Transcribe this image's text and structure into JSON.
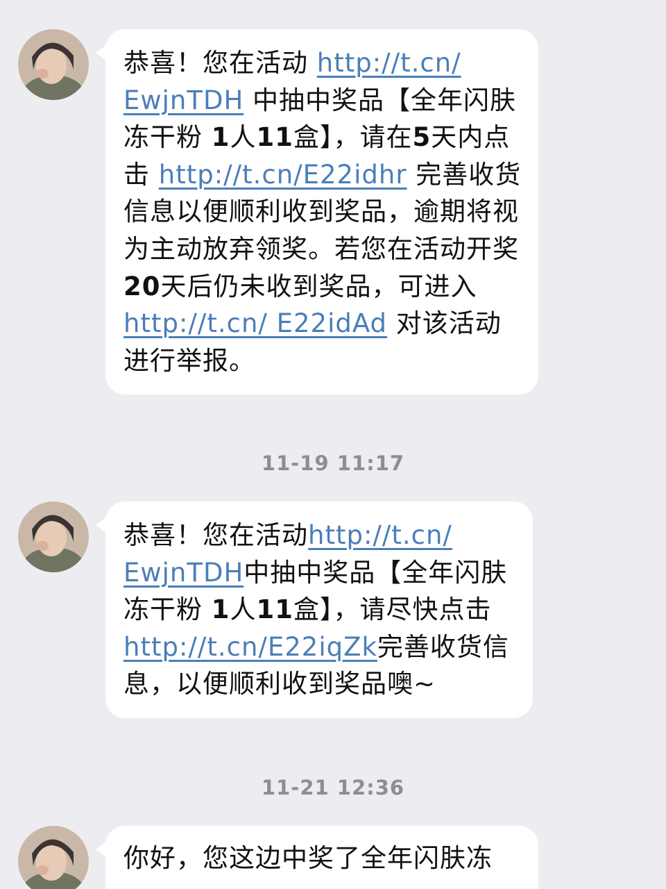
{
  "messages": [
    {
      "segments": [
        {
          "text": "恭喜！您在活动 "
        },
        {
          "text": "http://t.cn/ EwjnTDH",
          "link": true
        },
        {
          "text": " 中抽中奖品【全年闪肤冻干粉 "
        },
        {
          "text": "1",
          "bold": true
        },
        {
          "text": "人"
        },
        {
          "text": "11",
          "bold": true
        },
        {
          "text": "盒】，请在"
        },
        {
          "text": "5",
          "bold": true
        },
        {
          "text": "天内点击 "
        },
        {
          "text": "http://t.cn/E22idhr",
          "link": true
        },
        {
          "text": " 完善收货信息以便顺利收到奖品，逾期将视为主动放弃领奖。若您在活动开奖"
        },
        {
          "text": "20",
          "bold": true
        },
        {
          "text": "天后仍未收到奖品，可进入 "
        },
        {
          "text": "http://t.cn/ E22idAd",
          "link": true
        },
        {
          "text": " 对该活动进行举报。"
        }
      ]
    },
    {
      "segments": [
        {
          "text": "恭喜！您在活动"
        },
        {
          "text": "http://t.cn/ EwjnTDH",
          "link": true
        },
        {
          "text": "中抽中奖品【全年闪肤冻干粉 "
        },
        {
          "text": "1",
          "bold": true
        },
        {
          "text": "人"
        },
        {
          "text": "11",
          "bold": true
        },
        {
          "text": "盒】，请尽快点击"
        },
        {
          "text": "http://t.cn/E22iqZk",
          "link": true
        },
        {
          "text": "完善收货信息，以便顺利收到奖品噢~"
        }
      ]
    }
  ],
  "timestamps": [
    "11-19 11:17",
    "11-21 12:36"
  ],
  "third_message_visible_text": "你好，您这边中奖了全年闪肤冻"
}
